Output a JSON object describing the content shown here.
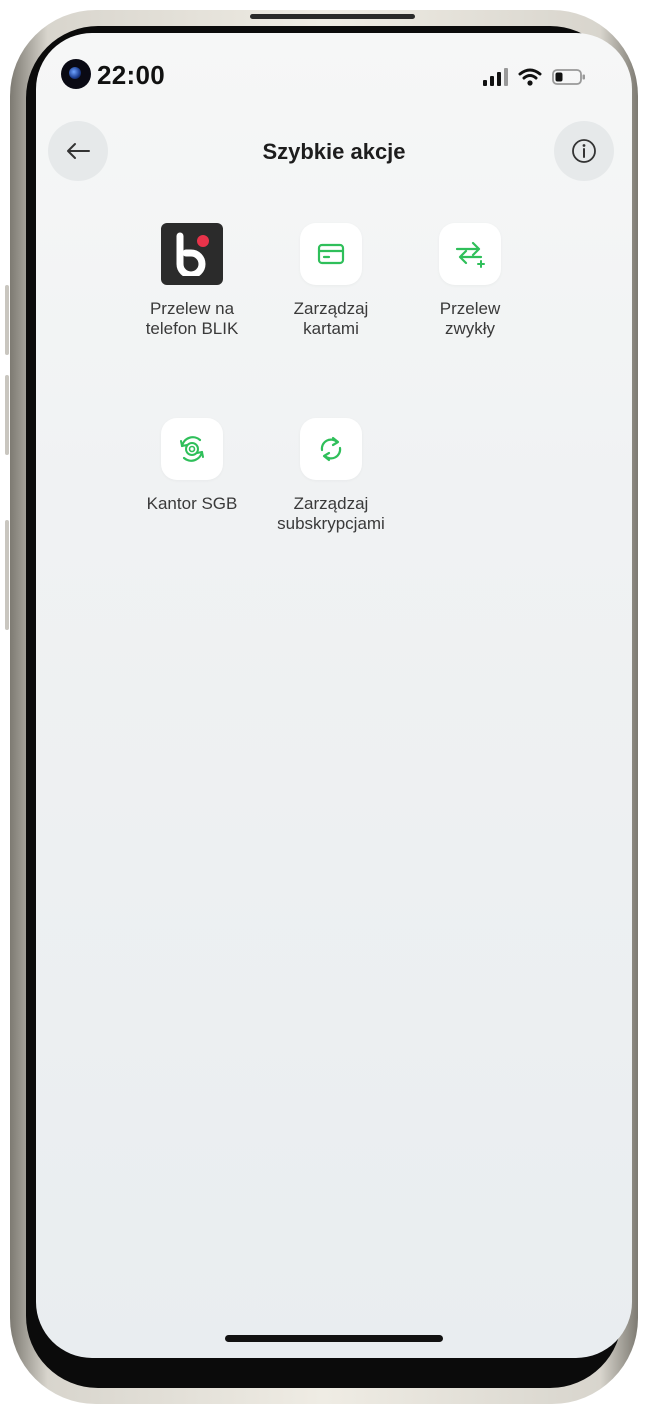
{
  "status_bar": {
    "time": "22:00",
    "icons": [
      "camera-icon",
      "signal-icon",
      "wifi-icon",
      "battery-icon"
    ]
  },
  "header": {
    "title": "Szybkie akcje",
    "back_icon": "arrow-left-icon",
    "info_icon": "info-icon"
  },
  "actions": [
    {
      "label": "Przelew na\ntelefon BLIK",
      "icon": "blik-icon"
    },
    {
      "label": "Zarządzaj\nkartami",
      "icon": "card-icon"
    },
    {
      "label": "Przelew\nzwykły",
      "icon": "transfer-icon"
    },
    {
      "label": "Kantor SGB",
      "icon": "currency-exchange-icon"
    },
    {
      "label": "Zarządzaj\nsubskrypcjami",
      "icon": "refresh-icon"
    }
  ],
  "colors": {
    "accent": "#2fbf5a",
    "title": "#1d1d1d",
    "label": "#3a3a3a",
    "blik_dot": "#e8334a"
  }
}
